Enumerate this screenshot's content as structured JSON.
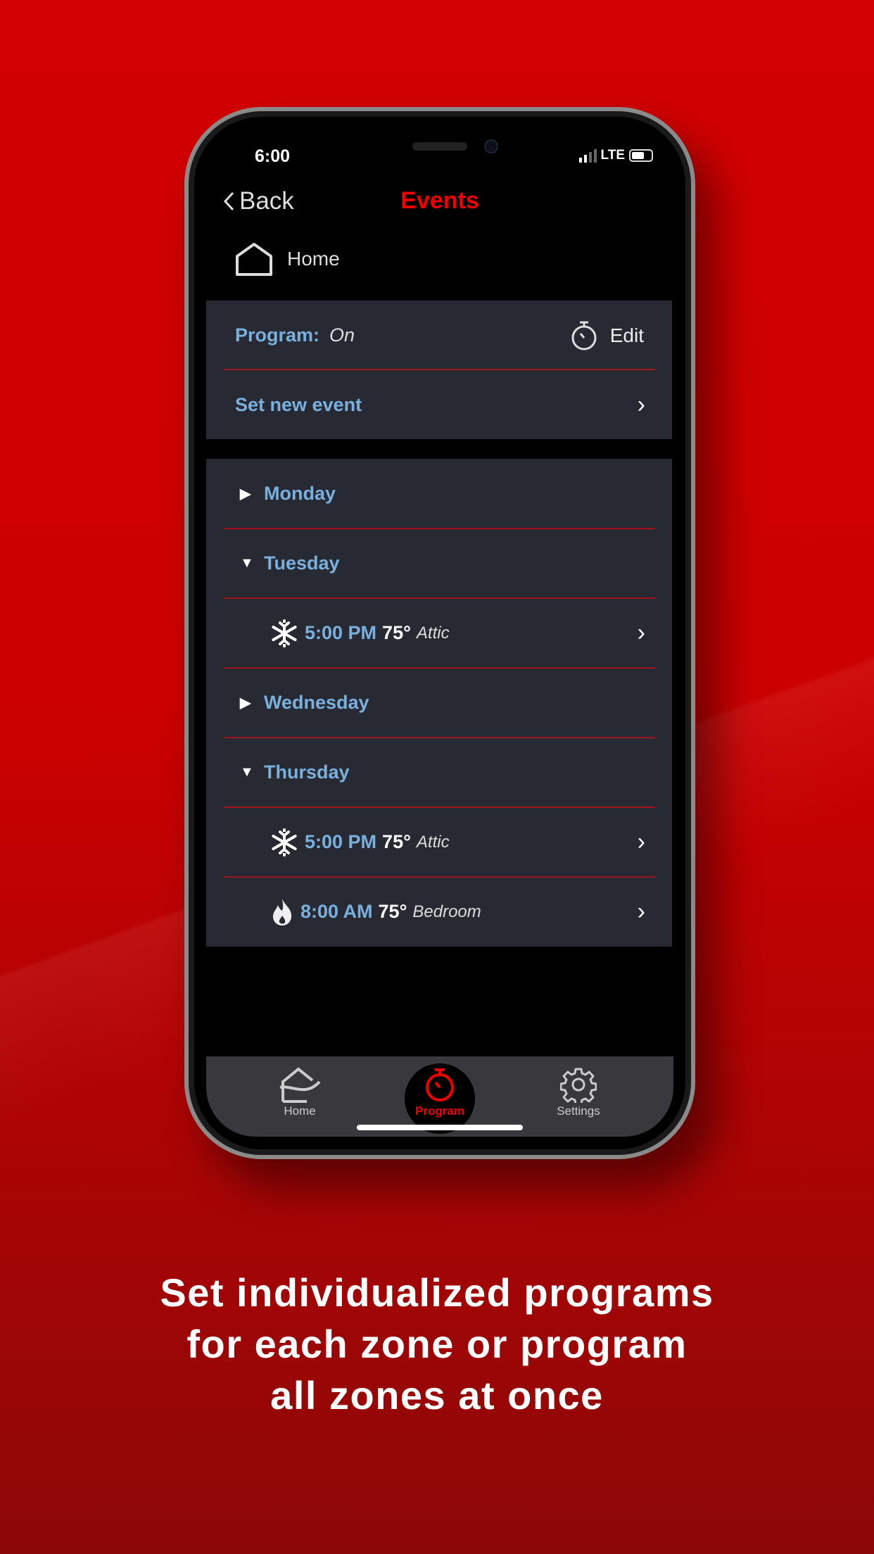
{
  "status_bar": {
    "time": "6:00",
    "network": "LTE"
  },
  "nav": {
    "back_label": "Back",
    "title": "Events"
  },
  "location": {
    "label": "Home"
  },
  "program": {
    "label": "Program:",
    "value": "On",
    "edit_label": "Edit"
  },
  "set_new_event": {
    "label": "Set new event"
  },
  "days": [
    {
      "name": "Monday",
      "expanded": false,
      "events": []
    },
    {
      "name": "Tuesday",
      "expanded": true,
      "events": [
        {
          "mode": "cool",
          "icon": "snowflake-icon",
          "time": "5:00 PM",
          "temp": "75°",
          "zone": "Attic"
        }
      ]
    },
    {
      "name": "Wednesday",
      "expanded": false,
      "events": []
    },
    {
      "name": "Thursday",
      "expanded": true,
      "events": [
        {
          "mode": "cool",
          "icon": "snowflake-icon",
          "time": "5:00 PM",
          "temp": "75°",
          "zone": "Attic"
        },
        {
          "mode": "heat",
          "icon": "flame-icon",
          "time": "8:00 AM",
          "temp": "75°",
          "zone": "Bedroom"
        }
      ]
    }
  ],
  "tabs": [
    {
      "label": "Home",
      "active": false
    },
    {
      "label": "Program",
      "active": true
    },
    {
      "label": "Settings",
      "active": false
    }
  ],
  "caption": [
    "Set individualized programs",
    "for each zone or program",
    "all zones at once"
  ],
  "colors": {
    "accent": "#f20000",
    "label_blue": "#7ab0de",
    "divider": "#a3141a",
    "card": "#282a33"
  }
}
